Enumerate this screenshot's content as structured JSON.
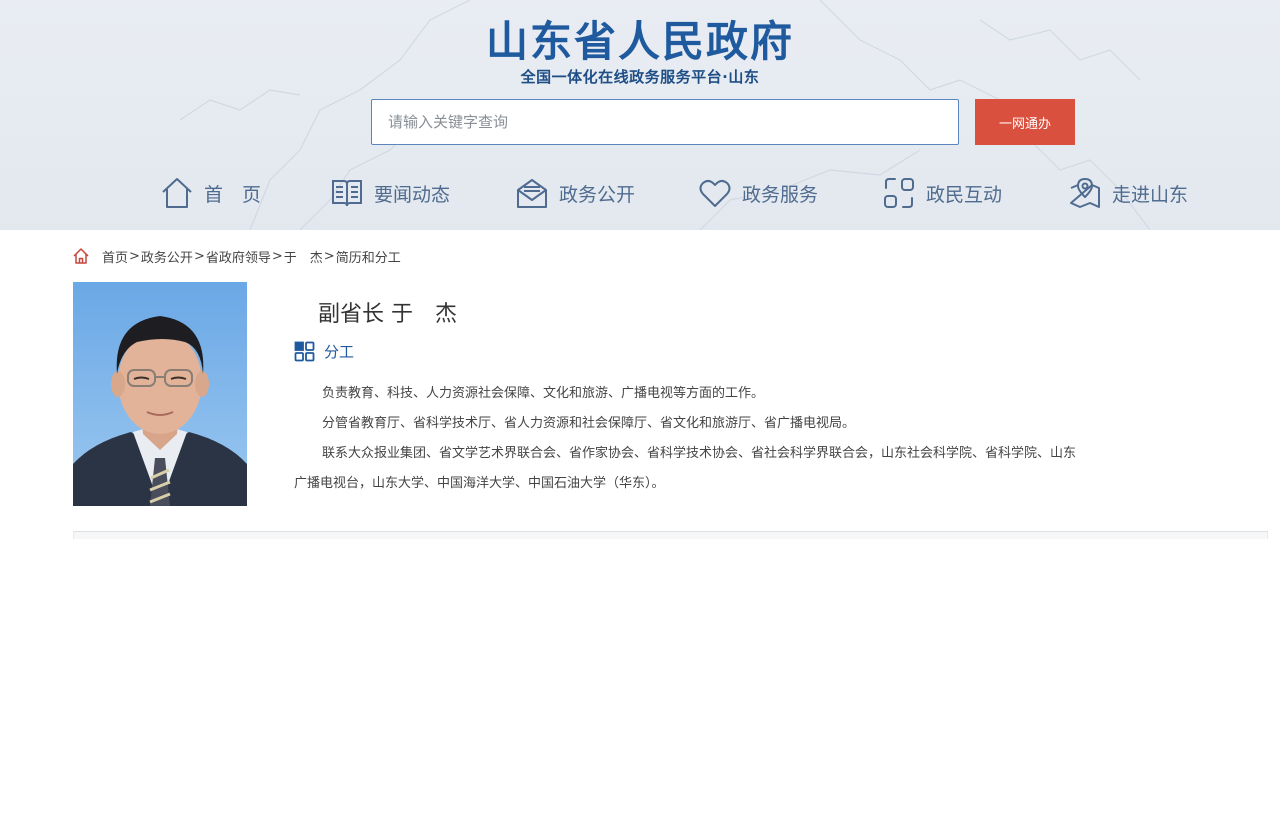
{
  "header": {
    "title": "山东省人民政府",
    "subtitle": "全国一体化在线政务服务平台·山东",
    "title_color": "#1f5a9e"
  },
  "search": {
    "placeholder": "请输入关键字查询",
    "value": "",
    "button_label": "一网通办",
    "button_color": "#d9503f"
  },
  "nav": {
    "items": [
      {
        "label": "首　页",
        "icon": "home-icon"
      },
      {
        "label": "要闻动态",
        "icon": "book-icon"
      },
      {
        "label": "政务公开",
        "icon": "mail-icon"
      },
      {
        "label": "政务服务",
        "icon": "heart-icon"
      },
      {
        "label": "政民互动",
        "icon": "interaction-icon"
      },
      {
        "label": "走进山东",
        "icon": "map-pin-icon"
      }
    ],
    "color": "#4f6b8f"
  },
  "breadcrumb": {
    "icon": "home-icon",
    "items": [
      "首页",
      "政务公开",
      "省政府领导",
      "于　杰",
      "简历和分工"
    ],
    "separator": ">"
  },
  "profile": {
    "name": "副省长 于　杰",
    "section_label": "分工",
    "section_icon": "grid-icon",
    "duties": [
      "负责教育、科技、人力资源社会保障、文化和旅游、广播电视等方面的工作。",
      "分管省教育厅、省科学技术厅、省人力资源和社会保障厅、省文化和旅游厅、省广播电视局。",
      "联系大众报业集团、省文学艺术界联合会、省作家协会、省科学技术协会、省社会科学界联合会，山东社会科学院、省科学院、山东广播电视台，山东大学、中国海洋大学、中国石油大学（华东）。"
    ]
  }
}
